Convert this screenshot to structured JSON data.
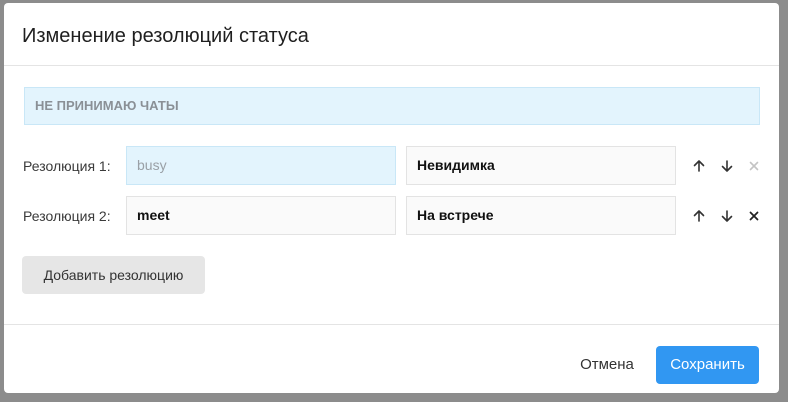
{
  "dialog": {
    "title": "Изменение резолюций статуса",
    "status_name": "НЕ ПРИНИМАЮ ЧАТЫ"
  },
  "resolutions": [
    {
      "label": "Резолюция 1:",
      "code": "busy",
      "name": "Невидимка",
      "remove_enabled": false
    },
    {
      "label": "Резолюция 2:",
      "code": "meet",
      "name": "На встрече",
      "remove_enabled": true
    }
  ],
  "actions": {
    "add_label": "Добавить резолюцию",
    "cancel_label": "Отмена",
    "save_label": "Сохранить"
  },
  "icons": {
    "move_up": "arrow-up-icon",
    "move_down": "arrow-down-icon",
    "remove": "close-icon"
  },
  "colors": {
    "accent": "#3197f2",
    "banner_bg": "#e3f4fd"
  }
}
